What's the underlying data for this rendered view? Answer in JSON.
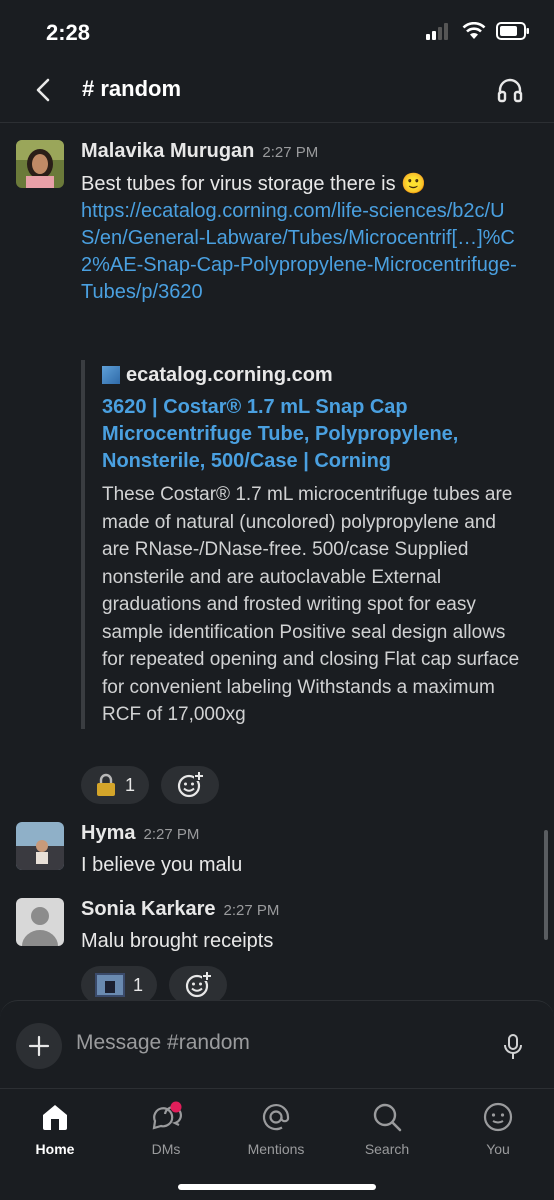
{
  "status": {
    "time": "2:28"
  },
  "header": {
    "channel": "# random"
  },
  "messages": [
    {
      "author": "Malavika Murugan",
      "time": "2:27 PM",
      "text": "Best tubes for virus storage there is 🙂",
      "link": "https://ecatalog.corning.com/life-sciences/b2c/US/en/General-Labware/Tubes/Microcentrif[…]%C2%AE-Snap-Cap-Polypropylene-Microcentrifuge-Tubes/p/3620",
      "unfurl": {
        "site": "ecatalog.corning.com",
        "title": "3620 | Costar® 1.7 mL Snap Cap Microcentrifuge Tube, Polypropylene, Nonsterile, 500/Case | Corning",
        "description": "These Costar® 1.7 mL microcentrifuge tubes are made of natural (uncolored) polypropylene and are RNase-/DNase-free. 500/case Supplied nonsterile and are autoclavable External graduations and frosted writing spot for easy sample identification Positive seal design allows for repeated opening and closing Flat cap surface for convenient labeling Withstands a maximum RCF of 17,000xg"
      },
      "reaction": {
        "emoji": "🔒",
        "count": "1"
      }
    },
    {
      "author": "Hyma",
      "time": "2:27 PM",
      "text": "I believe you malu"
    },
    {
      "author": "Sonia Karkare",
      "time": "2:27 PM",
      "text": "Malu brought receipts",
      "reaction": {
        "emoji": "image-emoji",
        "count": "1"
      }
    }
  ],
  "composer": {
    "placeholder": "Message #random"
  },
  "tabs": [
    {
      "label": "Home",
      "icon": "home-icon",
      "active": true
    },
    {
      "label": "DMs",
      "icon": "dms-icon",
      "badge_color": "#e01e5a"
    },
    {
      "label": "Mentions",
      "icon": "at-icon"
    },
    {
      "label": "Search",
      "icon": "search-icon"
    },
    {
      "label": "You",
      "icon": "you-icon"
    }
  ],
  "colors": {
    "background": "#1a1d21",
    "link": "#4aa0e0",
    "badge": "#e01e5a"
  }
}
